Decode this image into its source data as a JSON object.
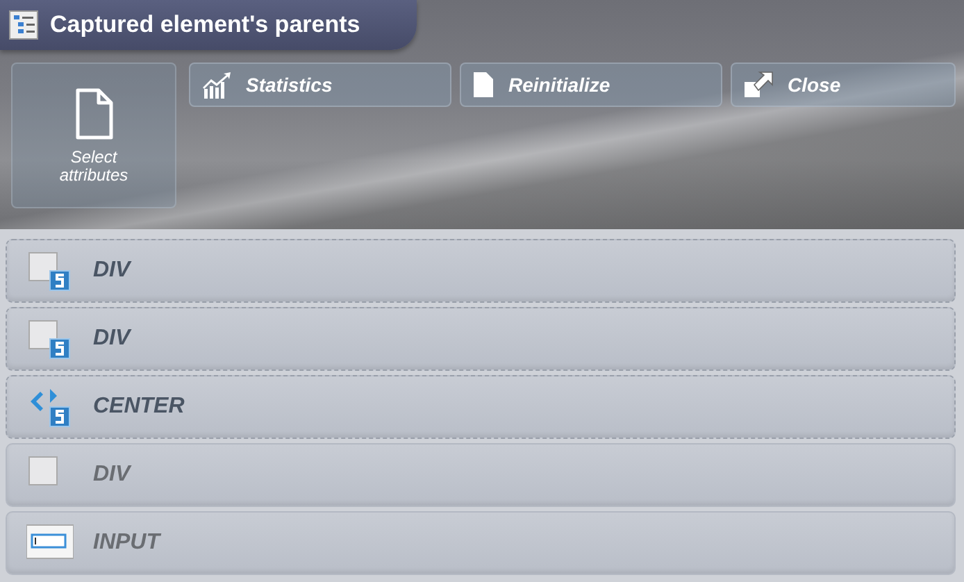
{
  "window": {
    "title": "Captured element's parents"
  },
  "select_button": {
    "label": "Select attributes"
  },
  "toolbar": [
    {
      "kind": "statistics",
      "label": "Statistics"
    },
    {
      "kind": "reinitialize",
      "label": "Reinitialize"
    },
    {
      "kind": "close",
      "label": "Close"
    }
  ],
  "parents": [
    {
      "tag": "DIV",
      "kind": "block",
      "styled": true
    },
    {
      "tag": "DIV",
      "kind": "block",
      "styled": true
    },
    {
      "tag": "CENTER",
      "kind": "center",
      "styled": true
    },
    {
      "tag": "DIV",
      "kind": "block",
      "styled": false
    },
    {
      "tag": "INPUT",
      "kind": "input",
      "styled": false
    }
  ]
}
